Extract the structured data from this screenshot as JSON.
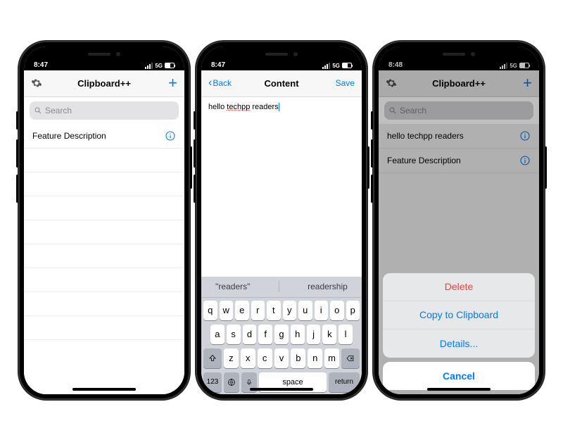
{
  "status": {
    "time_a": "8:47",
    "time_b": "8:47",
    "time_c": "8:48",
    "net": "5G"
  },
  "app": {
    "title": "Clipboard++",
    "search_placeholder": "Search"
  },
  "screen1": {
    "items": [
      {
        "text": "Feature Description"
      }
    ]
  },
  "editor": {
    "back": "Back",
    "title": "Content",
    "save": "Save",
    "text_prefix": "hello ",
    "text_red": "techpp",
    "text_suffix": " readers"
  },
  "keyboard": {
    "suggest1": "\"readers\"",
    "suggest2": "readership",
    "row1": [
      "q",
      "w",
      "e",
      "r",
      "t",
      "y",
      "u",
      "i",
      "o",
      "p"
    ],
    "row2": [
      "a",
      "s",
      "d",
      "f",
      "g",
      "h",
      "j",
      "k",
      "l"
    ],
    "row3": [
      "z",
      "x",
      "c",
      "v",
      "b",
      "n",
      "m"
    ],
    "num": "123",
    "space": "space",
    "return": "return"
  },
  "screen3": {
    "items": [
      {
        "text": "hello techpp readers"
      },
      {
        "text": "Feature Description"
      }
    ],
    "sheet": {
      "delete": "Delete",
      "copy": "Copy to Clipboard",
      "details": "Details...",
      "cancel": "Cancel"
    }
  }
}
